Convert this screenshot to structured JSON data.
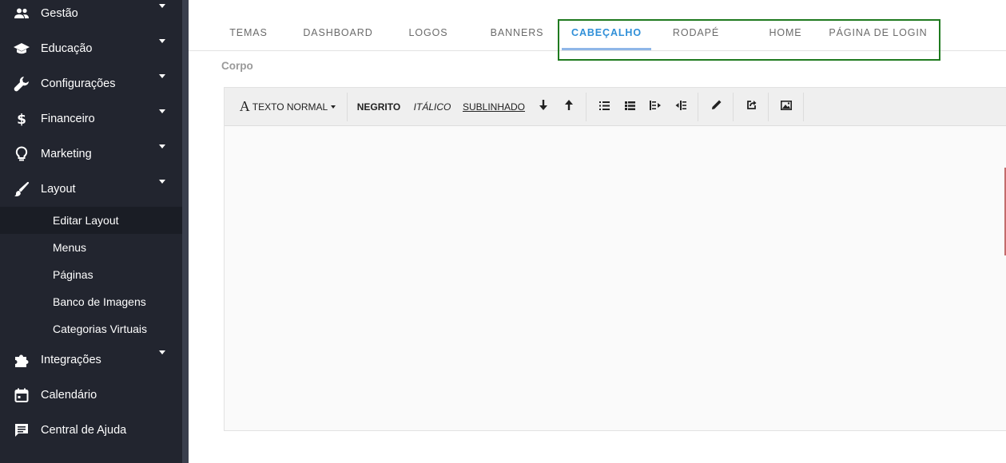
{
  "sidebar": {
    "items": [
      {
        "label": "Gestão",
        "icon": "users-icon"
      },
      {
        "label": "Educação",
        "icon": "graduation-cap-icon"
      },
      {
        "label": "Configurações",
        "icon": "wrench-icon"
      },
      {
        "label": "Financeiro",
        "icon": "dollar-icon"
      },
      {
        "label": "Marketing",
        "icon": "lightbulb-icon"
      },
      {
        "label": "Layout",
        "icon": "brush-icon"
      },
      {
        "label": "Integrações",
        "icon": "puzzle-icon"
      },
      {
        "label": "Calendário",
        "icon": "calendar-icon"
      },
      {
        "label": "Central de Ajuda",
        "icon": "chat-icon"
      }
    ],
    "layout_submenu": [
      "Editar Layout",
      "Menus",
      "Páginas",
      "Banco de Imagens",
      "Categorias Virtuais"
    ]
  },
  "tabs": [
    "TEMAS",
    "DASHBOARD",
    "LOGOS",
    "BANNERS",
    "CABEÇALHO",
    "RODAPÉ",
    "HOME",
    "PÁGINA DE LOGIN"
  ],
  "active_tab": "CABEÇALHO",
  "section_label": "Corpo",
  "toolbar": {
    "font_letter": "A",
    "font_style": "TEXTO NORMAL",
    "bold": "NEGRITO",
    "italic": "ITÁLICO",
    "underline": "SUBLINHADO",
    "icons": [
      "arrow-down-icon",
      "arrow-up-icon",
      "unordered-list-icon",
      "ordered-list-icon",
      "outdent-icon",
      "indent-icon",
      "pencil-icon",
      "link-icon",
      "image-icon"
    ]
  },
  "colors": {
    "sidebar_bg": "#22252f",
    "active_tab": "#2f8fd8",
    "highlight_box": "#1f7a1f"
  }
}
